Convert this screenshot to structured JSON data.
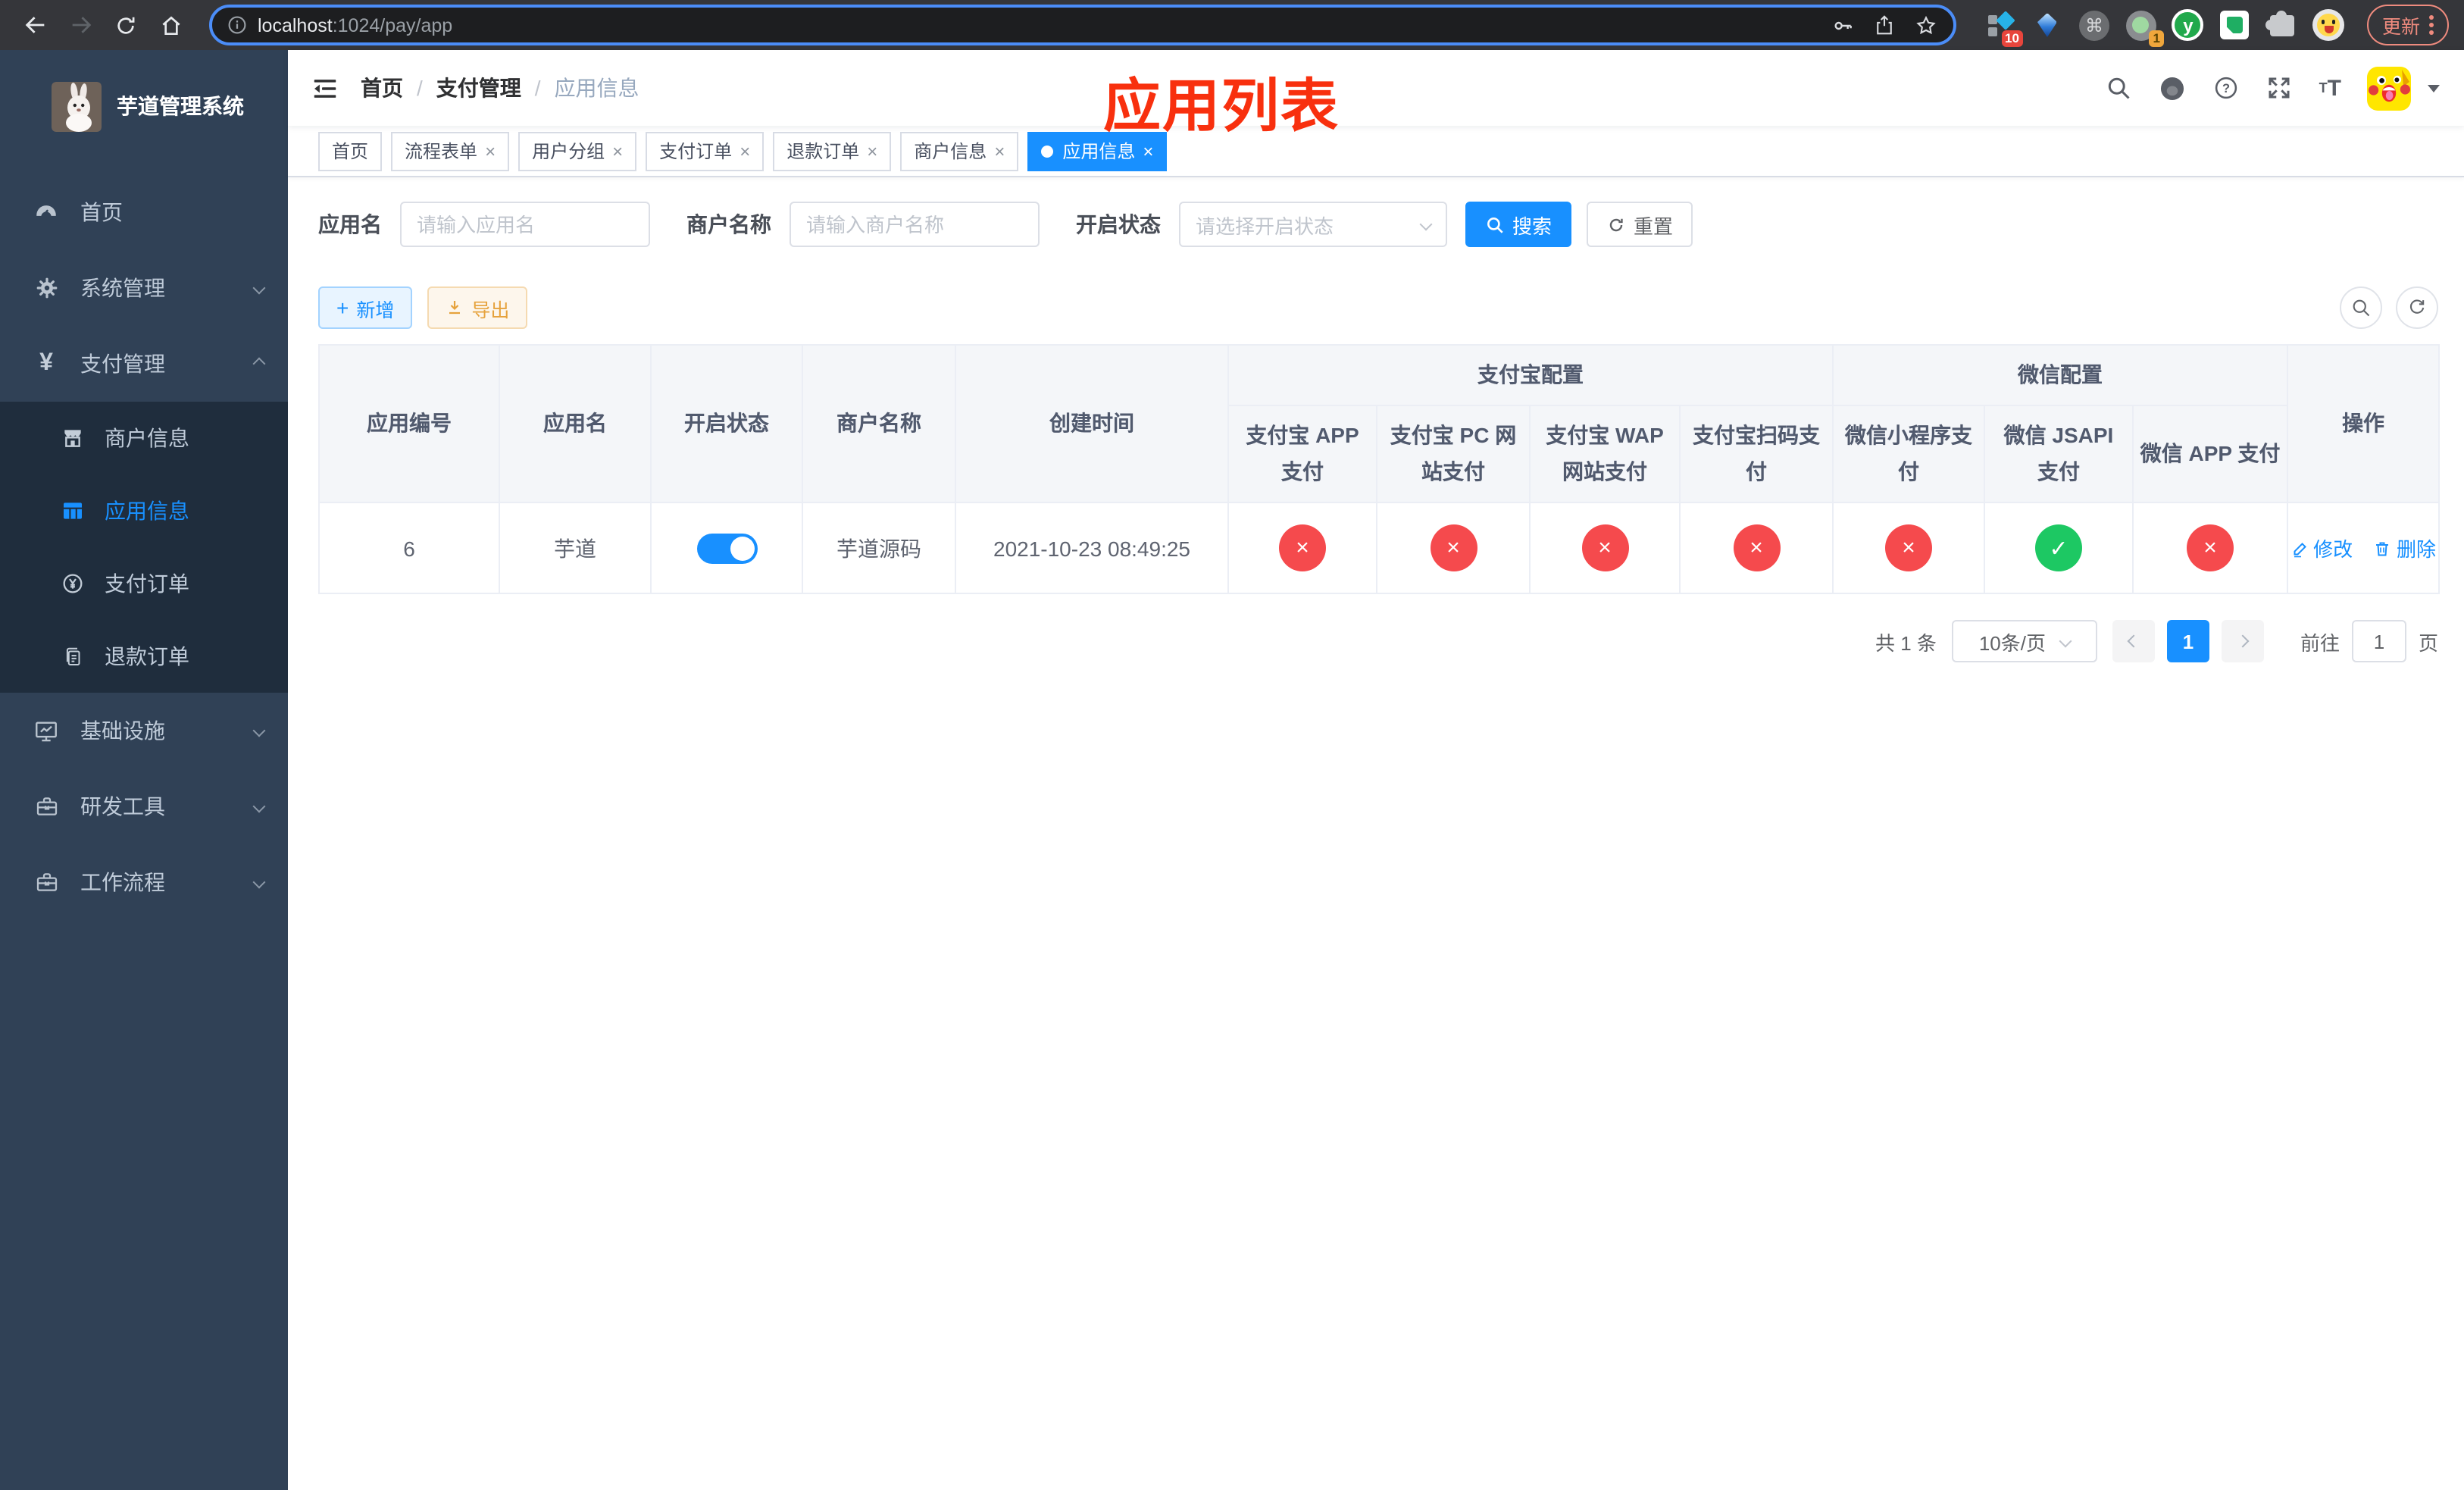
{
  "browser": {
    "url_host": "localhost",
    "url_path": ":1024/pay/app",
    "update_label": "更新",
    "ext_grid_badge": "10",
    "ext_donut_badge": "1",
    "ext_y_letter": "y",
    "ext_cmd_glyph": "⌘"
  },
  "sidebar": {
    "title": "芋道管理系统",
    "items": {
      "home": "首页",
      "system": "系统管理",
      "payment": "支付管理",
      "merchant": "商户信息",
      "app_info": "应用信息",
      "pay_order": "支付订单",
      "refund_order": "退款订单",
      "infra": "基础设施",
      "dev_tools": "研发工具",
      "workflow": "工作流程"
    }
  },
  "navbar": {
    "breadcrumb": {
      "home": "首页",
      "level1": "支付管理",
      "current": "应用信息"
    }
  },
  "annotation": "应用列表",
  "tabs": [
    {
      "label": "首页"
    },
    {
      "label": "流程表单",
      "close": "×"
    },
    {
      "label": "用户分组",
      "close": "×"
    },
    {
      "label": "支付订单",
      "close": "×"
    },
    {
      "label": "退款订单",
      "close": "×"
    },
    {
      "label": "商户信息",
      "close": "×"
    },
    {
      "label": "应用信息",
      "close": "×",
      "active": true
    }
  ],
  "filters": {
    "app_name_label": "应用名",
    "app_name_placeholder": "请输入应用名",
    "merchant_label": "商户名称",
    "merchant_placeholder": "请输入商户名称",
    "status_label": "开启状态",
    "status_placeholder": "请选择开启状态",
    "search_label": "搜索",
    "reset_label": "重置"
  },
  "toolbar": {
    "add_label": "新增",
    "export_label": "导出"
  },
  "table": {
    "headers": {
      "app_id": "应用编号",
      "app_name": "应用名",
      "status": "开启状态",
      "merchant": "商户名称",
      "create_time": "创建时间",
      "alipay_group": "支付宝配置",
      "wechat_group": "微信配置",
      "alipay_app": "支付宝 APP 支付",
      "alipay_pc": "支付宝 PC 网站支付",
      "alipay_wap": "支付宝 WAP 网站支付",
      "alipay_qr": "支付宝扫码支付",
      "wx_mini": "微信小程序支付",
      "wx_jsapi": "微信 JSAPI 支付",
      "wx_app": "微信 APP 支付",
      "actions": "操作"
    },
    "row": {
      "app_id": "6",
      "app_name": "芋道",
      "status_on": true,
      "merchant": "芋道源码",
      "create_time": "2021-10-23 08:49:25",
      "pay_status": [
        "error",
        "error",
        "error",
        "error",
        "error",
        "success",
        "error"
      ],
      "edit_label": "修改",
      "delete_label": "删除"
    }
  },
  "pagination": {
    "total_text": "共 1 条",
    "page_size": "10条/页",
    "current_page": "1",
    "goto_label": "前往",
    "goto_value": "1",
    "page_suffix": "页"
  },
  "colors": {
    "accent": "#1890ff",
    "danger": "#f54a4d",
    "success": "#1dc863"
  }
}
